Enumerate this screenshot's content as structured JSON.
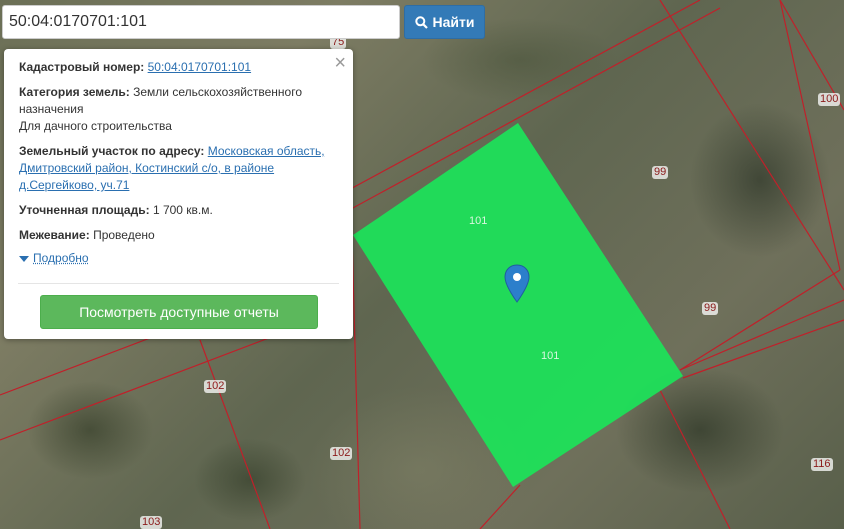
{
  "search": {
    "value": "50:04:0170701:101",
    "button_label": "Найти"
  },
  "popup": {
    "cadastral_label": "Кадастровый номер:",
    "cadastral_value": "50:04:0170701:101",
    "category_label": "Категория земель:",
    "category_value": "Земли сельскохозяйственного назначения",
    "usage_value": "Для дачного строительства",
    "address_label": "Земельный участок по адресу:",
    "address_value": "Московская область, Дмитровский район, Костинский с/о, в районе д.Сергейково, уч.71",
    "area_label": "Уточненная площадь:",
    "area_value": "1 700 кв.м.",
    "survey_label": "Межевание:",
    "survey_value": "Проведено",
    "details_label": "Подробно",
    "report_button": "Посмотреть доступные отчеты",
    "close_symbol": "×"
  },
  "map": {
    "lot_labels": [
      "75",
      "100",
      "99",
      "99",
      "102",
      "102",
      "116",
      "103"
    ],
    "selected_lot_labels": [
      "101",
      "101"
    ],
    "selected_color": "#1ee05a",
    "boundary_color": "#c0202a",
    "marker_icon": "map-pin-icon"
  }
}
